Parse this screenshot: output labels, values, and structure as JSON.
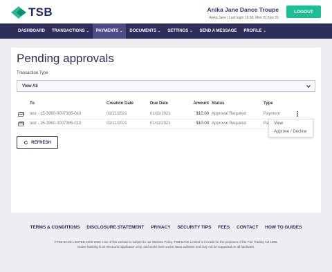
{
  "brand": {
    "name": "TSB",
    "accent": "#1cbf94",
    "navy": "#2d2d5a"
  },
  "header": {
    "org_name": "Anika Jane Dance Troupe",
    "last_login": "Anika Jane | Last login 16:30, Mon 01 Nov 21",
    "logout_label": "LOGOUT"
  },
  "nav": {
    "items": [
      {
        "label": "DASHBOARD",
        "has_caret": false,
        "active": false
      },
      {
        "label": "TRANSACTIONS",
        "has_caret": true,
        "active": false
      },
      {
        "label": "PAYMENTS",
        "has_caret": true,
        "active": true
      },
      {
        "label": "DOCUMENTS",
        "has_caret": true,
        "active": false
      },
      {
        "label": "SETTINGS",
        "has_caret": true,
        "active": false
      },
      {
        "label": "SEND A MESSAGE",
        "has_caret": false,
        "active": false
      },
      {
        "label": "PROFILE",
        "has_caret": true,
        "active": false
      }
    ],
    "caret_glyph": "⌄"
  },
  "main": {
    "title": "Pending approvals",
    "filter_label": "Transaction Type",
    "filter_value": "View All",
    "columns": [
      "To",
      "Creation Date",
      "Due Date",
      "Amount",
      "Status",
      "Type"
    ],
    "rows": [
      {
        "to": "test - 15-3960-0007385-010",
        "created": "01/11/2021",
        "due": "01/11/2021",
        "amount": "$10.00",
        "status": "Approval Required",
        "type": "Payment"
      },
      {
        "to": "test - 15-3960-0007385-010",
        "created": "01/11/2021",
        "due": "01/11/2021",
        "amount": "$10.00",
        "status": "Approval Required",
        "type": "Pa"
      }
    ],
    "row_menu": {
      "items": [
        "View",
        "Approve / Decline"
      ]
    },
    "refresh_label": "REFRESH"
  },
  "footer": {
    "links": [
      "TERMS & CONDITIONS",
      "DISCLOSURE STATEMENT",
      "PRIVACY",
      "SECURITY TIPS",
      "FEES",
      "CONTACT",
      "HOW TO GUIDES"
    ],
    "legal_line1": "©TSB BANK LIMITED 2008-2020. Use of this website is subject to our Website Policy. TSB BANK Limited is in trade for the purposes of the Fair Trading Act 1986.",
    "legal_line2": "Online banking is an electronic application only, and works best on the latest software and may not be supported on all hardware."
  }
}
